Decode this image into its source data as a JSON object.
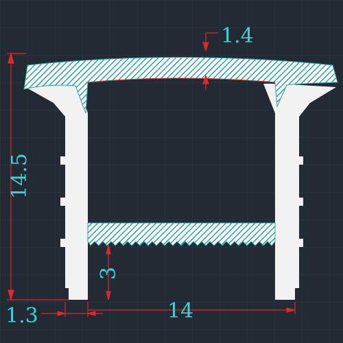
{
  "drawing": {
    "colors": {
      "background": "#222a33",
      "grid": "#2f3b47",
      "profile_fill": "#f2f2f2",
      "hatch": "#2aa3a8",
      "dimension_line": "#e0282c",
      "dimension_text": "#3fd0d8"
    },
    "dimensions": {
      "top_thickness": "1.4",
      "overall_height": "14.5",
      "bottom_rib_height": "3",
      "wall_thickness": "1.3",
      "overall_width": "14"
    }
  }
}
